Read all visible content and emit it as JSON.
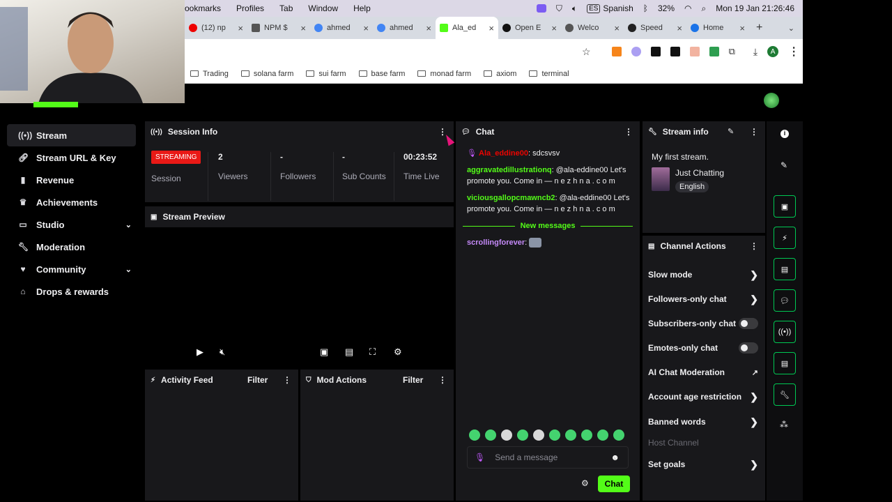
{
  "menubar": {
    "items": [
      "ookmarks",
      "Profiles",
      "Tab",
      "Window",
      "Help"
    ],
    "lang": "Spanish",
    "lang_code": "ES",
    "battery": "32%",
    "datetime": "Mon 19 Jan  21:26:46"
  },
  "browser": {
    "tabs": [
      {
        "label": "(12) np"
      },
      {
        "label": "NPM $"
      },
      {
        "label": "ahmed"
      },
      {
        "label": "ahmed"
      },
      {
        "label": "Ala_ed"
      },
      {
        "label": "Open E"
      },
      {
        "label": "Welco"
      },
      {
        "label": "Speed"
      },
      {
        "label": "Home"
      }
    ],
    "profile_letter": "A",
    "bookmarks": [
      "Trading",
      "solana farm",
      "sui farm",
      "base farm",
      "monad farm",
      "axiom",
      "terminal"
    ]
  },
  "sidebar": {
    "items": [
      {
        "label": "Stream",
        "icon": "broadcast-icon"
      },
      {
        "label": "Stream URL & Key",
        "icon": "link-icon"
      },
      {
        "label": "Revenue",
        "icon": "chart-icon"
      },
      {
        "label": "Achievements",
        "icon": "trophy-icon"
      },
      {
        "label": "Studio",
        "icon": "studio-icon"
      },
      {
        "label": "Moderation",
        "icon": "wrench-icon"
      },
      {
        "label": "Community",
        "icon": "heart-icon"
      },
      {
        "label": "Drops & rewards",
        "icon": "gift-icon"
      }
    ]
  },
  "session": {
    "title": "Session Info",
    "badge": "STREAMING",
    "session_label": "Session",
    "stats": [
      {
        "value": "2",
        "label": "Viewers"
      },
      {
        "value": "-",
        "label": "Followers"
      },
      {
        "value": "-",
        "label": "Sub Counts"
      },
      {
        "value": "00:23:52",
        "label": "Time Live"
      }
    ]
  },
  "preview": {
    "title": "Stream Preview"
  },
  "activity": {
    "title": "Activity Feed",
    "filter": "Filter"
  },
  "mod": {
    "title": "Mod Actions",
    "filter": "Filter"
  },
  "chat": {
    "title": "Chat",
    "messages": [
      {
        "user": "Ala_eddine00",
        "color": "#eb0400",
        "text": "sdcsvsv"
      },
      {
        "user": "aggravatedillustrationq",
        "color": "#53fc18",
        "text": "@ala-eddine00 Let's promote you. Come in — n e z h n a . c o m"
      },
      {
        "user": "viciousgallopcmawncb2",
        "color": "#53fc18",
        "text": "@ala-eddine00 Let's promote you. Come in — n e z h n a . c o m"
      }
    ],
    "new_messages": "New messages",
    "last": {
      "user": "scrollingforever",
      "color": "#c58af9"
    },
    "input_placeholder": "Send a message",
    "send": "Chat"
  },
  "stream_info": {
    "title": "Stream info",
    "stream_title": "My first stream.",
    "category": "Just Chatting",
    "language": "English"
  },
  "channel_actions": {
    "title": "Channel Actions",
    "items": [
      {
        "label": "Slow mode",
        "kind": "arrow"
      },
      {
        "label": "Followers-only chat",
        "kind": "arrow"
      },
      {
        "label": "Subscribers-only chat",
        "kind": "toggle"
      },
      {
        "label": "Emotes-only chat",
        "kind": "toggle"
      },
      {
        "label": "AI Chat Moderation",
        "kind": "external"
      },
      {
        "label": "Account age restriction",
        "kind": "arrow"
      },
      {
        "label": "Banned words",
        "kind": "arrow"
      },
      {
        "label": "Host Channel",
        "kind": "disabled"
      },
      {
        "label": "Set goals",
        "kind": "arrow"
      }
    ]
  },
  "colors": {
    "accent": "#53fc18",
    "live": "#e91916",
    "panel": "#18181b"
  }
}
